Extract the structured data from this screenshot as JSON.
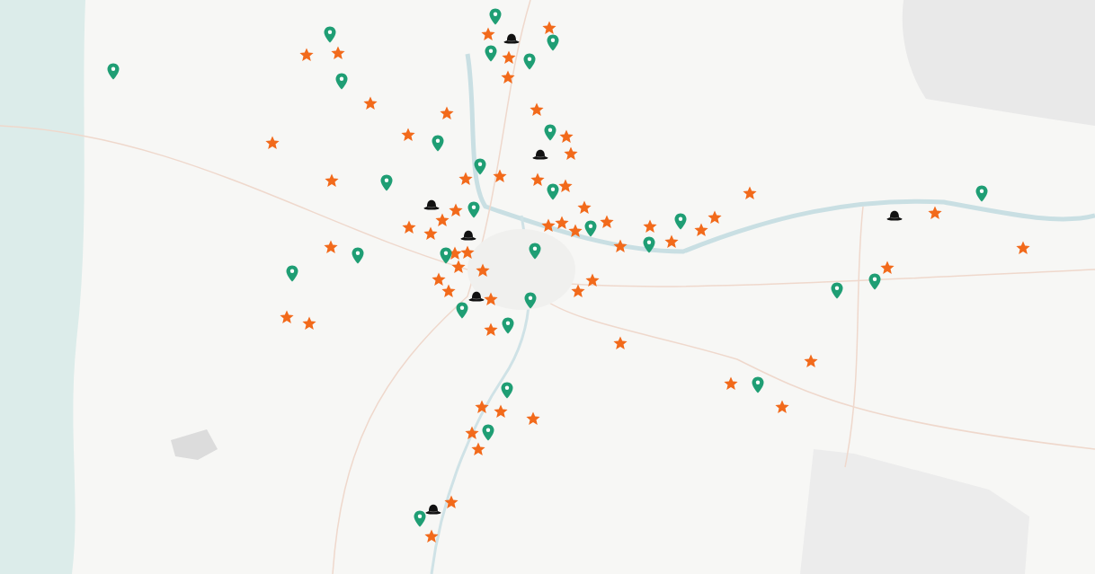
{
  "markers": [
    {
      "kind": "star"
    },
    {
      "kind": "star"
    },
    {
      "kind": "star"
    },
    {
      "kind": "star"
    },
    {
      "kind": "star"
    },
    {
      "kind": "star"
    },
    {
      "kind": "star"
    },
    {
      "kind": "star"
    },
    {
      "kind": "star"
    },
    {
      "kind": "star"
    },
    {
      "kind": "star"
    },
    {
      "kind": "star"
    },
    {
      "kind": "star"
    },
    {
      "kind": "star"
    },
    {
      "kind": "star"
    },
    {
      "kind": "star"
    },
    {
      "kind": "star"
    },
    {
      "kind": "star"
    },
    {
      "kind": "star"
    },
    {
      "kind": "star"
    },
    {
      "kind": "star"
    },
    {
      "kind": "star"
    },
    {
      "kind": "star"
    },
    {
      "kind": "star"
    },
    {
      "kind": "star"
    },
    {
      "kind": "star"
    },
    {
      "kind": "star"
    },
    {
      "kind": "star"
    },
    {
      "kind": "star"
    },
    {
      "kind": "star"
    },
    {
      "kind": "star"
    },
    {
      "kind": "star"
    },
    {
      "kind": "star"
    },
    {
      "kind": "star"
    },
    {
      "kind": "star"
    },
    {
      "kind": "star"
    },
    {
      "kind": "star"
    },
    {
      "kind": "star"
    },
    {
      "kind": "star"
    },
    {
      "kind": "star"
    },
    {
      "kind": "star"
    },
    {
      "kind": "star"
    },
    {
      "kind": "star"
    },
    {
      "kind": "star"
    },
    {
      "kind": "star"
    },
    {
      "kind": "star"
    },
    {
      "kind": "star"
    },
    {
      "kind": "star"
    },
    {
      "kind": "star"
    },
    {
      "kind": "star"
    },
    {
      "kind": "star"
    },
    {
      "kind": "star"
    },
    {
      "kind": "star"
    },
    {
      "kind": "star"
    },
    {
      "kind": "star"
    },
    {
      "kind": "star"
    },
    {
      "kind": "star"
    },
    {
      "kind": "star"
    },
    {
      "kind": "star"
    },
    {
      "kind": "star"
    },
    {
      "kind": "pin"
    },
    {
      "kind": "pin"
    },
    {
      "kind": "pin"
    },
    {
      "kind": "pin"
    },
    {
      "kind": "pin"
    },
    {
      "kind": "pin"
    },
    {
      "kind": "pin"
    },
    {
      "kind": "pin"
    },
    {
      "kind": "pin"
    },
    {
      "kind": "pin"
    },
    {
      "kind": "pin"
    },
    {
      "kind": "pin"
    },
    {
      "kind": "pin"
    },
    {
      "kind": "pin"
    },
    {
      "kind": "pin"
    },
    {
      "kind": "pin"
    },
    {
      "kind": "pin"
    },
    {
      "kind": "pin"
    },
    {
      "kind": "pin"
    },
    {
      "kind": "pin"
    },
    {
      "kind": "pin"
    },
    {
      "kind": "pin"
    },
    {
      "kind": "pin"
    },
    {
      "kind": "pin"
    },
    {
      "kind": "pin"
    },
    {
      "kind": "pin"
    },
    {
      "kind": "pin"
    },
    {
      "kind": "pin"
    },
    {
      "kind": "pin"
    },
    {
      "kind": "pin"
    },
    {
      "kind": "hat"
    },
    {
      "kind": "hat"
    },
    {
      "kind": "hat"
    },
    {
      "kind": "hat"
    },
    {
      "kind": "hat"
    },
    {
      "kind": "hat"
    },
    {
      "kind": "hat"
    }
  ]
}
